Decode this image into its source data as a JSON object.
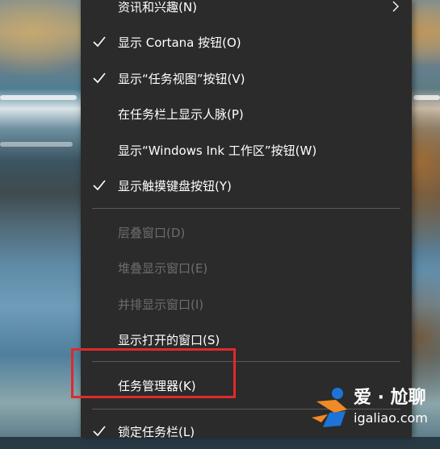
{
  "menu": {
    "items": [
      {
        "label": "资讯和兴趣(N)",
        "checked": false,
        "disabled": false,
        "submenu": true
      },
      {
        "label": "显示 Cortana 按钮(O)",
        "checked": true,
        "disabled": false,
        "submenu": false
      },
      {
        "label": "显示“任务视图”按钮(V)",
        "checked": true,
        "disabled": false,
        "submenu": false
      },
      {
        "label": "在任务栏上显示人脉(P)",
        "checked": false,
        "disabled": false,
        "submenu": false
      },
      {
        "label": "显示“Windows Ink 工作区”按钮(W)",
        "checked": false,
        "disabled": false,
        "submenu": false
      },
      {
        "label": "显示触摸键盘按钮(Y)",
        "checked": true,
        "disabled": false,
        "submenu": false
      },
      {
        "label": "层叠窗口(D)",
        "checked": false,
        "disabled": true,
        "submenu": false
      },
      {
        "label": "堆叠显示窗口(E)",
        "checked": false,
        "disabled": true,
        "submenu": false
      },
      {
        "label": "并排显示窗口(I)",
        "checked": false,
        "disabled": true,
        "submenu": false
      },
      {
        "label": "显示打开的窗口(S)",
        "checked": false,
        "disabled": false,
        "submenu": false
      },
      {
        "label": "任务管理器(K)",
        "checked": false,
        "disabled": false,
        "submenu": false
      },
      {
        "label": "锁定任务栏(L)",
        "checked": true,
        "disabled": false,
        "submenu": false
      }
    ]
  },
  "highlight": {
    "color": "#e02a2a",
    "target_item": "任务管理器(K)"
  },
  "watermark": {
    "text": "爱 · 尬聊",
    "url": "igaliao.com"
  },
  "colors": {
    "menu_bg": "#2b2b2b",
    "text": "#ffffff",
    "disabled_text": "#6d6d6d",
    "separator": "#5a5a5a"
  }
}
